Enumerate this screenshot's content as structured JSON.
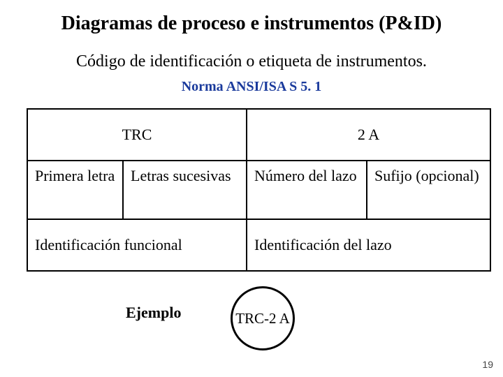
{
  "title": "Diagramas de proceso e instrumentos (P&ID)",
  "subtitle": "Código de identificación o etiqueta de instrumentos.",
  "norma": "Norma ANSI/ISA S 5. 1",
  "table": {
    "header_left": "TRC",
    "header_right": "2 A",
    "row2": {
      "c1": "Primera letra",
      "c2": "Letras sucesivas",
      "c3": "Número del lazo",
      "c4": "Sufijo (opcional)"
    },
    "row3": {
      "left": "Identificación funcional",
      "right": "Identificación del lazo"
    }
  },
  "example_label": "Ejemplo",
  "example_value": "TRC-2 A",
  "page_number": "19"
}
